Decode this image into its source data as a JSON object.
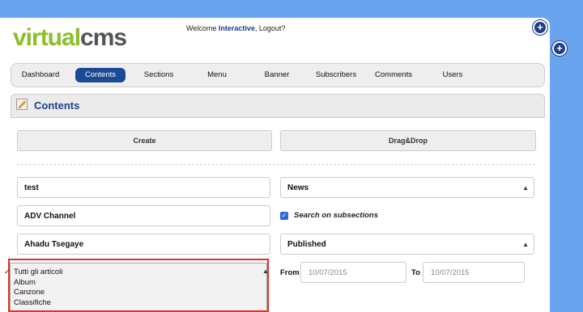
{
  "brand": {
    "logo_part1": "virtual",
    "logo_part2": "cms"
  },
  "header": {
    "welcome_prefix": "Welcome ",
    "user": "Interactive",
    "logout": ", Logout?"
  },
  "nav": {
    "items": [
      "Dashboard",
      "Contents",
      "Sections",
      "Menu",
      "Banner",
      "Subscribers",
      "Comments",
      "Users"
    ],
    "active": "Contents"
  },
  "section": {
    "title": "Contents"
  },
  "buttons": {
    "create": "Create",
    "dragdrop": "Drag&Drop"
  },
  "filters": {
    "text1": "test",
    "text2": "ADV Channel",
    "text3": "Ahadu Tsegaye",
    "type_select": "News",
    "search_subsections_label": "Search on subsections",
    "status_select": "Published",
    "from_label": "From",
    "from_date": "10/07/2015",
    "to_label": "To",
    "to_date": "10/07/2015"
  },
  "category_dropdown": {
    "options": [
      "Tutti gli articoli",
      "Album",
      "Canzone",
      "Classifiche"
    ],
    "selected": "Tutti gli articoli"
  },
  "colors": {
    "accent": "#1b4a95",
    "logo_green": "#8cbf2a",
    "highlight": "#e0322c",
    "background": "#6aa3ee"
  }
}
